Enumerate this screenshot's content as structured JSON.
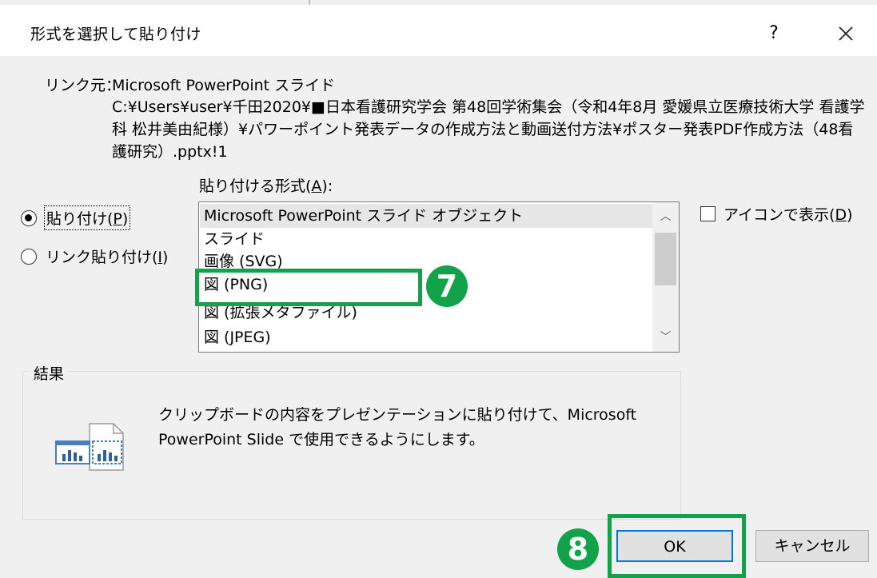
{
  "titlebar": {
    "title": "形式を選択して貼り付け",
    "help_label": "?"
  },
  "source": {
    "label": "リンク元：",
    "name": "Microsoft PowerPoint スライド",
    "path": "C:¥Users¥user¥千田2020¥■日本看護研究学会 第48回学術集会（令和4年8月 愛媛県立医療技術大学 看護学科 松井美由紀様）¥パワーポイント発表データの作成方法と動画送付方法¥ポスター発表PDF作成方法（48看護研究）.pptx!1"
  },
  "format_list": {
    "label_before": "貼り付ける形式(",
    "label_key": "A",
    "label_after": "):",
    "items": [
      "Microsoft PowerPoint スライド オブジェクト",
      "スライド",
      "画像 (SVG)",
      "図 (PNG)",
      "図 (拡張メタファイル)",
      "図 (JPEG)"
    ],
    "selected_index": 0
  },
  "radios": {
    "paste_before": "貼り付け(",
    "paste_key": "P",
    "paste_after": ")",
    "link_before": "リンク貼り付け(",
    "link_key": "I",
    "link_after": ")",
    "selected": "paste"
  },
  "icon_option": {
    "before": "アイコンで表示(",
    "key": "D",
    "after": ")",
    "checked": false
  },
  "result": {
    "label": "結果",
    "description": "クリップボードの内容をプレゼンテーションに貼り付けて、Microsoft PowerPoint Slide で使用できるようにします。"
  },
  "buttons": {
    "ok": "OK",
    "cancel": "キャンセル"
  },
  "annotations": {
    "step7": "7",
    "step8": "8",
    "color": "#12a24a"
  },
  "icons": {
    "help": "question-icon",
    "close": "close-icon",
    "result": "paste-slide-icon"
  }
}
